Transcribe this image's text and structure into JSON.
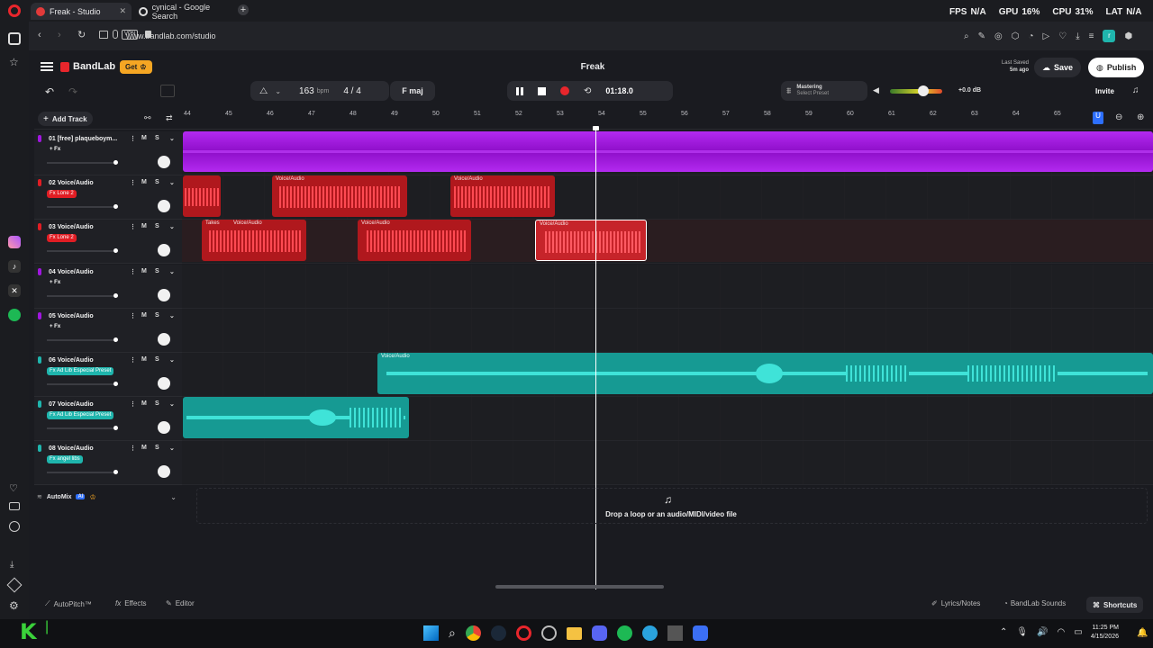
{
  "browser": {
    "tabs": [
      {
        "title": "Freak - Studio"
      },
      {
        "title": "cynical - Google Search"
      }
    ],
    "url": "www.bandlab.com/studio",
    "vpn": "VPN",
    "stats": {
      "fps_label": "FPS",
      "fps": "N/A",
      "gpu_label": "GPU",
      "gpu": "16%",
      "cpu_label": "CPU",
      "cpu": "31%",
      "lat_label": "LAT",
      "lat": "N/A"
    }
  },
  "studio": {
    "brand": "BandLab",
    "get_label": "Get",
    "project_title": "Freak",
    "last_saved_label": "Last Saved",
    "last_saved_time": "5m ago",
    "save_label": "Save",
    "publish_label": "Publish",
    "invite_label": "Invite",
    "bpm": "163",
    "bpm_unit": "bpm",
    "time_signature": "4 / 4",
    "key": "F maj",
    "time_display": "01:18.0",
    "mastering_label": "Mastering",
    "mastering_preset": "Select Preset",
    "master_volume": "+0.0 dB",
    "add_track_label": "Add Track",
    "drop_text": "Drop a loop or an audio/MIDI/video file",
    "automix_label": "AutoMix",
    "ai_badge": "AI"
  },
  "ruler": [
    "44",
    "45",
    "46",
    "47",
    "48",
    "49",
    "50",
    "51",
    "52",
    "53",
    "54",
    "55",
    "56",
    "57",
    "58",
    "59",
    "60",
    "61",
    "62",
    "63",
    "64",
    "65"
  ],
  "tracks": [
    {
      "name": "01  [free] plaqueboym...",
      "fx": "+ Fx",
      "fx_style": "plain",
      "color": "#a116e0"
    },
    {
      "name": "02  Voice/Audio",
      "fx": "Fx  Lone 2",
      "fx_style": "tag",
      "color": "#e11d24"
    },
    {
      "name": "03  Voice/Audio",
      "fx": "Fx  Lone 2",
      "fx_style": "tag",
      "color": "#e11d24"
    },
    {
      "name": "04  Voice/Audio",
      "fx": "+ Fx",
      "fx_style": "plain",
      "color": "#a116e0"
    },
    {
      "name": "05  Voice/Audio",
      "fx": "+ Fx",
      "fx_style": "plain",
      "color": "#a116e0"
    },
    {
      "name": "06  Voice/Audio",
      "fx": "Fx  Ad Lib Especial Preset",
      "fx_style": "tag",
      "color": "#1fb5ad"
    },
    {
      "name": "07  Voice/Audio",
      "fx": "Fx  Ad Lib Especial Preset",
      "fx_style": "tag",
      "color": "#1fb5ad"
    },
    {
      "name": "08  Voice/Audio",
      "fx": "Fx  angel libs",
      "fx_style": "tag",
      "color": "#1fb5ad"
    }
  ],
  "track_buttons": {
    "mute": "M",
    "solo": "S"
  },
  "clip_labels": {
    "voice": "Voice/Audio",
    "takes": "Takes"
  },
  "bottom": {
    "autopitch": "AutoPitch™",
    "effects": "Effects",
    "editor": "Editor",
    "lyrics": "Lyrics/Notes",
    "sounds": "BandLab Sounds",
    "shortcuts": "Shortcuts"
  },
  "taskbar": {
    "time": "11:25 PM",
    "date": "4/15/2026"
  },
  "colors": {
    "purple": "#a116e0",
    "red": "#e11d24",
    "teal": "#1fb5ad",
    "accent_orange": "#ff7a00"
  }
}
